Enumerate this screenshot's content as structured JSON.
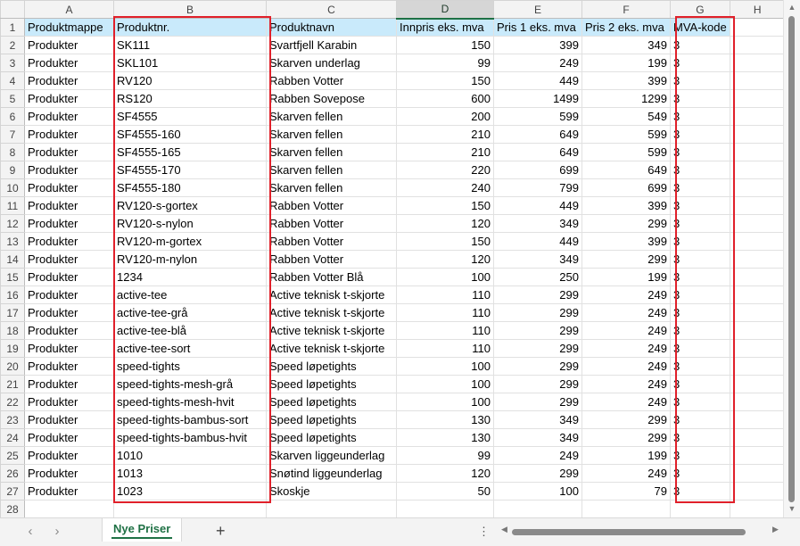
{
  "columns": [
    "A",
    "B",
    "C",
    "D",
    "E",
    "F",
    "G",
    "H"
  ],
  "selected_column": "D",
  "header_row": [
    "Produktmappe",
    "Produktnr.",
    "Produktnavn",
    "Innpris eks. mva",
    "Pris 1 eks. mva",
    "Pris 2 eks. mva",
    "MVA-kode"
  ],
  "rows": [
    [
      "Produkter",
      "SK111",
      "Svartfjell Karabin",
      "150",
      "399",
      "349",
      "3"
    ],
    [
      "Produkter",
      "SKL101",
      "Skarven underlag",
      "99",
      "249",
      "199",
      "3"
    ],
    [
      "Produkter",
      "RV120",
      "Rabben Votter",
      "150",
      "449",
      "399",
      "3"
    ],
    [
      "Produkter",
      "RS120",
      "Rabben Sovepose",
      "600",
      "1499",
      "1299",
      "3"
    ],
    [
      "Produkter",
      "SF4555",
      "Skarven fellen",
      "200",
      "599",
      "549",
      "3"
    ],
    [
      "Produkter",
      "SF4555-160",
      "Skarven fellen",
      "210",
      "649",
      "599",
      "3"
    ],
    [
      "Produkter",
      "SF4555-165",
      "Skarven fellen",
      "210",
      "649",
      "599",
      "3"
    ],
    [
      "Produkter",
      "SF4555-170",
      "Skarven fellen",
      "220",
      "699",
      "649",
      "3"
    ],
    [
      "Produkter",
      "SF4555-180",
      "Skarven fellen",
      "240",
      "799",
      "699",
      "3"
    ],
    [
      "Produkter",
      "RV120-s-gortex",
      "Rabben Votter",
      "150",
      "449",
      "399",
      "3"
    ],
    [
      "Produkter",
      "RV120-s-nylon",
      "Rabben Votter",
      "120",
      "349",
      "299",
      "3"
    ],
    [
      "Produkter",
      "RV120-m-gortex",
      "Rabben Votter",
      "150",
      "449",
      "399",
      "3"
    ],
    [
      "Produkter",
      "RV120-m-nylon",
      "Rabben Votter",
      "120",
      "349",
      "299",
      "3"
    ],
    [
      "Produkter",
      "1234",
      "Rabben Votter Blå",
      "100",
      "250",
      "199",
      "3"
    ],
    [
      "Produkter",
      "active-tee",
      "Active teknisk t-skjorte",
      "110",
      "299",
      "249",
      "3"
    ],
    [
      "Produkter",
      "active-tee-grå",
      "Active teknisk t-skjorte",
      "110",
      "299",
      "249",
      "3"
    ],
    [
      "Produkter",
      "active-tee-blå",
      "Active teknisk t-skjorte",
      "110",
      "299",
      "249",
      "3"
    ],
    [
      "Produkter",
      "active-tee-sort",
      "Active teknisk t-skjorte",
      "110",
      "299",
      "249",
      "3"
    ],
    [
      "Produkter",
      "speed-tights",
      "Speed løpetights",
      "100",
      "299",
      "249",
      "3"
    ],
    [
      "Produkter",
      "speed-tights-mesh-grå",
      "Speed løpetights",
      "100",
      "299",
      "249",
      "3"
    ],
    [
      "Produkter",
      "speed-tights-mesh-hvit",
      "Speed løpetights",
      "100",
      "299",
      "249",
      "3"
    ],
    [
      "Produkter",
      "speed-tights-bambus-sort",
      "Speed løpetights",
      "130",
      "349",
      "299",
      "3"
    ],
    [
      "Produkter",
      "speed-tights-bambus-hvit",
      "Speed løpetights",
      "130",
      "349",
      "299",
      "3"
    ],
    [
      "Produkter",
      "1010",
      "Skarven liggeunderlag",
      "99",
      "249",
      "199",
      "3"
    ],
    [
      "Produkter",
      "1013",
      "Snøtind liggeunderlag",
      "120",
      "299",
      "249",
      "3"
    ],
    [
      "Produkter",
      "1023",
      "Skoskje",
      "50",
      "100",
      "79",
      "3"
    ]
  ],
  "empty_row_number": "28",
  "numeric_columns": [
    3,
    4,
    5
  ],
  "sheet_tab": "Nye Priser",
  "add_sheet_icon": "+",
  "more_icon": "⋮",
  "nav_prev_icon": "‹",
  "nav_next_icon": "›",
  "colors": {
    "title_row_fill": "#c9eafb",
    "highlight_box": "#e0202a",
    "accent": "#1f7145"
  }
}
